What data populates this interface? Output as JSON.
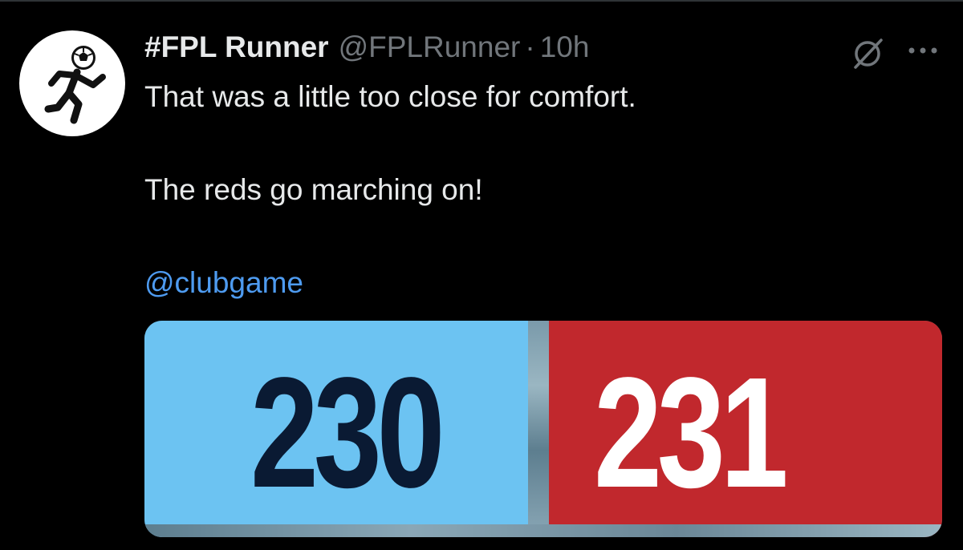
{
  "tweet": {
    "display_name": "#FPL Runner",
    "handle": "@FPLRunner",
    "separator": "·",
    "time": "10h",
    "text_line1": "That was a little too close for comfort.",
    "text_line2": "The reds go marching on!",
    "mention": "@clubgame"
  },
  "icons": {
    "avatar": "soccer-runner-icon",
    "grok": "grok-icon",
    "more": "more-icon"
  },
  "media": {
    "left_score": "230",
    "right_score": "231",
    "left_color": "#6cc3f2",
    "right_color": "#c1282d"
  }
}
